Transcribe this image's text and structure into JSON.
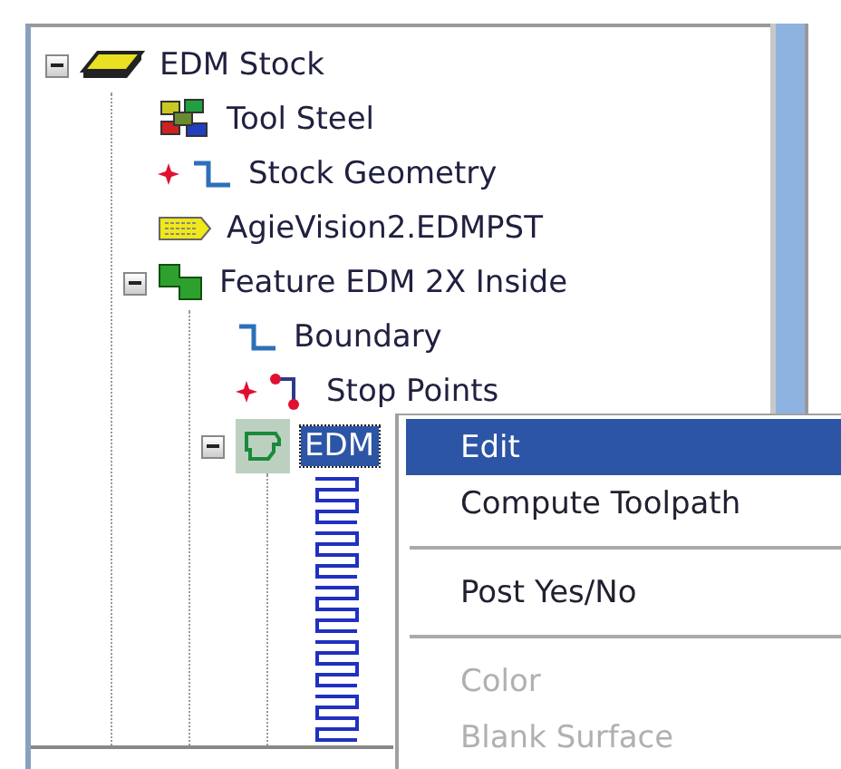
{
  "tree": [
    {
      "label": "EDM Stock",
      "kind": "stock",
      "expanded": true,
      "flagged": false,
      "selected": false,
      "children": [
        {
          "label": "Tool Steel",
          "kind": "material",
          "flagged": false,
          "selected": false
        },
        {
          "label": "Stock Geometry",
          "kind": "geometry",
          "flagged": true,
          "selected": false
        },
        {
          "label": "AgieVision2.EDMPST",
          "kind": "post",
          "flagged": false,
          "selected": false
        },
        {
          "label": "Feature EDM 2X Inside",
          "kind": "feature",
          "expanded": true,
          "flagged": false,
          "selected": false,
          "children": [
            {
              "label": "Boundary",
              "kind": "geometry",
              "flagged": false,
              "selected": false
            },
            {
              "label": "Stop Points",
              "kind": "stop-points",
              "flagged": true,
              "selected": false
            },
            {
              "label": "EDM",
              "kind": "operation",
              "expanded": true,
              "flagged": false,
              "selected": true,
              "children": [
                {
                  "kind": "toolpath"
                },
                {
                  "kind": "toolpath"
                },
                {
                  "kind": "toolpath"
                },
                {
                  "kind": "toolpath"
                },
                {
                  "kind": "toolpath"
                }
              ]
            }
          ]
        }
      ]
    }
  ],
  "context_menu": [
    {
      "kind": "item",
      "label": "Edit",
      "selected": true,
      "disabled": false
    },
    {
      "kind": "item",
      "label": "Compute Toolpath",
      "selected": false,
      "disabled": false
    },
    {
      "kind": "separator"
    },
    {
      "kind": "item",
      "label": "Post Yes/No",
      "selected": false,
      "disabled": false
    },
    {
      "kind": "separator"
    },
    {
      "kind": "item",
      "label": "Color",
      "selected": false,
      "disabled": true
    },
    {
      "kind": "item",
      "label": "Blank Surface",
      "selected": false,
      "disabled": true
    }
  ]
}
